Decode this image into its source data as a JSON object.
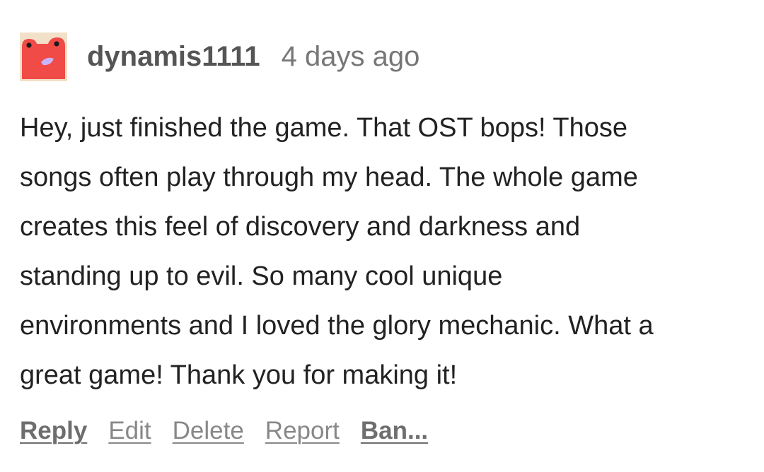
{
  "comment": {
    "author": "dynamis1111",
    "timestamp": "4 days ago",
    "avatar_icon": "red-frog-face-icon",
    "body_lines": [
      "Hey, just finished the game. That OST bops! Those",
      "songs often play through my head. The whole game",
      "creates this feel of discovery and darkness and",
      "standing up to evil. So many cool unique",
      "environments and I loved the glory mechanic. What a",
      "great game! Thank you for making it!"
    ],
    "actions": {
      "reply": "Reply",
      "edit": "Edit",
      "delete": "Delete",
      "report": "Report",
      "ban": "Ban..."
    }
  },
  "colors": {
    "avatar_bg": "#f04b46",
    "avatar_border": "#f3e0c8",
    "mouth": "#c8b4ff",
    "text": "#222222",
    "author": "#555555",
    "muted": "#888888"
  }
}
